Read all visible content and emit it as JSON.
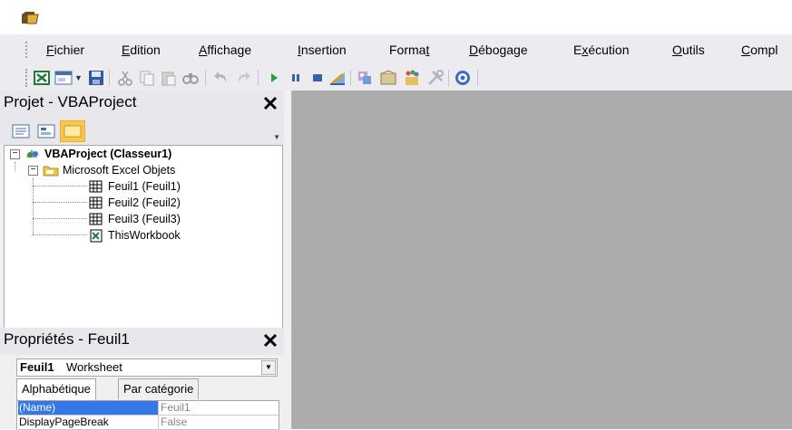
{
  "menubar": {
    "items": [
      {
        "pre": "",
        "u": "F",
        "post": "ichier"
      },
      {
        "pre": "",
        "u": "E",
        "post": "dition"
      },
      {
        "pre": "",
        "u": "A",
        "post": "ffichage"
      },
      {
        "pre": "",
        "u": "I",
        "post": "nsertion"
      },
      {
        "pre": "Forma",
        "u": "t",
        "post": ""
      },
      {
        "pre": "",
        "u": "D",
        "post": "ébogage"
      },
      {
        "pre": "E",
        "u": "x",
        "post": "écution"
      },
      {
        "pre": "",
        "u": "O",
        "post": "utils"
      },
      {
        "pre": "",
        "u": "C",
        "post": "ompl"
      }
    ]
  },
  "toolbar": {
    "icons": [
      "excel-view-icon",
      "insert-userform-icon",
      "dropdown-arrow-icon",
      "save-icon",
      "cut-icon",
      "copy-icon",
      "paste-icon",
      "find-icon",
      "undo-icon",
      "redo-icon",
      "run-icon",
      "break-icon",
      "reset-icon",
      "design-mode-icon",
      "project-explorer-icon",
      "properties-icon",
      "object-browser-icon",
      "toolbox-icon",
      "help-icon"
    ]
  },
  "project_pane": {
    "title": "Projet - VBAProject",
    "tree": {
      "root": "VBAProject (Classeur1)",
      "folder": "Microsoft Excel Objets",
      "sheets": [
        "Feuil1 (Feuil1)",
        "Feuil2 (Feuil2)",
        "Feuil3 (Feuil3)"
      ],
      "workbook": "ThisWorkbook"
    }
  },
  "properties_pane": {
    "title": "Propriétés - Feuil1",
    "object_name": "Feuil1",
    "object_type": "Worksheet",
    "tabs": [
      "Alphabétique",
      "Par catégorie"
    ],
    "rows": [
      {
        "name": "(Name)",
        "value": "Feuil1"
      },
      {
        "name": "DisplayPageBreak",
        "value": "False"
      }
    ]
  },
  "colors": {
    "menu_bg": "#ececf0",
    "mdi_background": "#acacac",
    "selection": "#3578e5"
  }
}
